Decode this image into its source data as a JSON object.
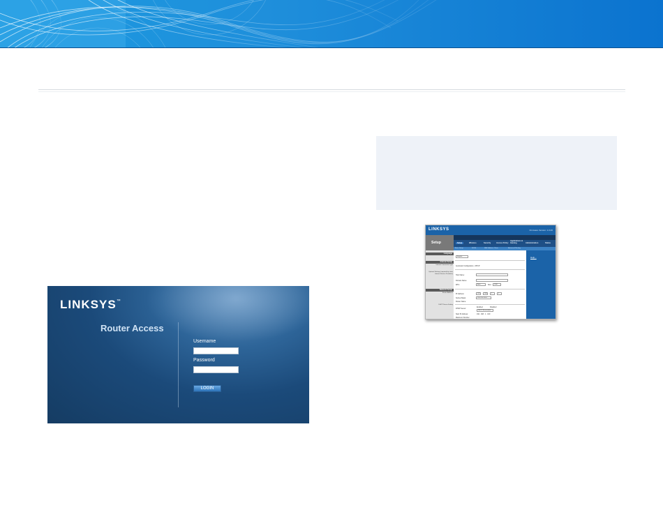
{
  "banner": {
    "colors": {
      "light": "#1b9ae0",
      "dark": "#0b73cf"
    }
  },
  "login_screenshot": {
    "logo": "LINKSYS",
    "logo_mark": "™",
    "title": "Router Access",
    "username_label": "Username",
    "password_label": "Password",
    "login_button": "LOGIN"
  },
  "setup_screenshot": {
    "logo": "LINKSYS",
    "firmware": "Firmware Version: 1.0.00",
    "section": "Setup",
    "tabs": [
      "Setup",
      "Wireless",
      "Security",
      "Access Policy",
      "Applications & Gaming",
      "Administration",
      "Status"
    ],
    "subtabs": [
      "Basic Setup",
      "DDNS",
      "MAC Address Clone",
      "Advanced Routing"
    ],
    "left_headers": [
      "Language",
      "Internet Setup",
      "Network Setup"
    ],
    "left_labels": [
      "Internet Connection Type",
      "Optional Settings (required by some Internet Service Providers)",
      "Router Address",
      "DHCP Server Setting"
    ],
    "language_value": "English",
    "connection_label": "Automatic Configuration - DHCP",
    "field_labels": [
      "Host Name:",
      "Domain Name:",
      "MTU:",
      "IP Address:",
      "Subnet Mask:",
      "Router Name:",
      "DHCP Server:",
      "Start IP Address:",
      "Maximum Number"
    ],
    "mtu_value": "Auto",
    "size_label": "Size:",
    "size_value": "1500",
    "ip_values": [
      "192",
      "168",
      "1",
      "1"
    ],
    "subnet_value": "255.255.255.0",
    "dhcp_enabled": "Enabled",
    "dhcp_disabled": "Disabled",
    "dhcp_reservation": "DHCP Reservation",
    "start_ip": "192 . 168 . 1 . 100",
    "help": "Help..."
  }
}
